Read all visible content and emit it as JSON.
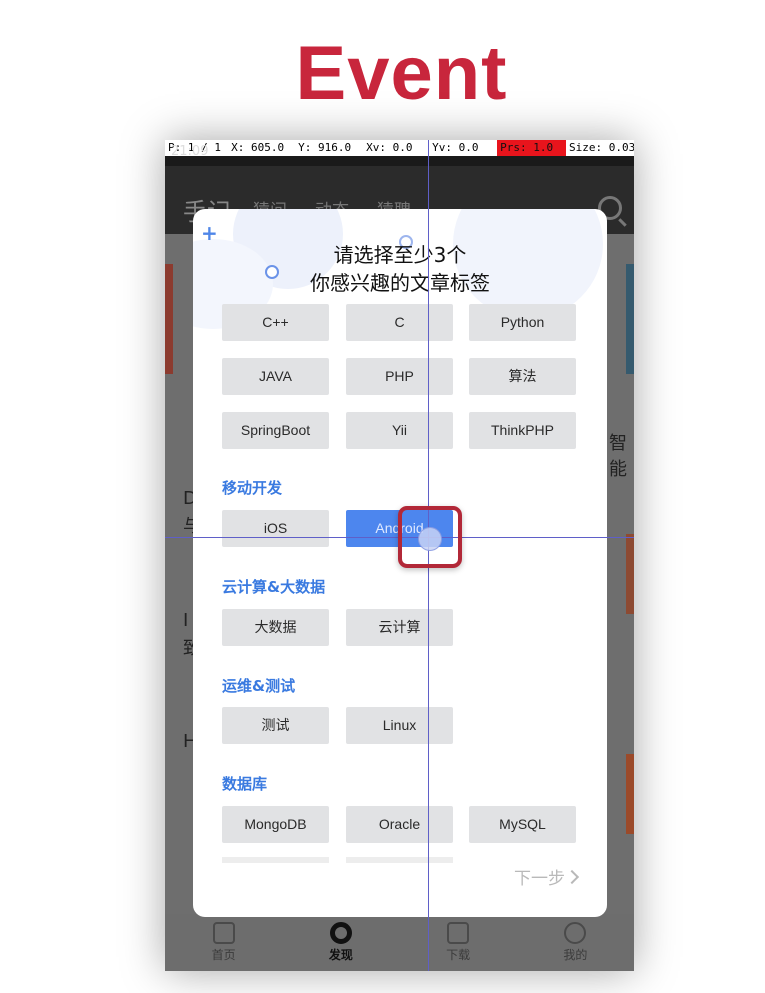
{
  "slide": {
    "title": "Event"
  },
  "debug_bar": {
    "p": "P: 1 / 1",
    "x": "X: 605.0",
    "y": "Y: 916.0",
    "xv": "Xv: 0.0",
    "yv": "Yv: 0.0",
    "prs": "Prs: 1.0",
    "size": "Size: 0.03"
  },
  "status_bar": {
    "time": "21:09"
  },
  "app_bar": {
    "logo": "手记",
    "tabs": [
      "猿问",
      "动态",
      "猿聘"
    ]
  },
  "background": {
    "right_text": "智能",
    "left_letters": [
      "D",
      "与",
      "I",
      "致",
      "H"
    ]
  },
  "dialog": {
    "title_line1": "请选择至少3个",
    "title_line2": "你感兴趣的文章标签",
    "groups": [
      {
        "heading": "",
        "tags": [
          "C++",
          "C",
          "Python",
          "JAVA",
          "PHP",
          "算法",
          "SpringBoot",
          "Yii",
          "ThinkPHP"
        ]
      },
      {
        "heading": "移动开发",
        "tags": [
          "iOS",
          "Android"
        ],
        "selected": "Android"
      },
      {
        "heading": "云计算&大数据",
        "tags": [
          "大数据",
          "云计算"
        ]
      },
      {
        "heading": "运维&测试",
        "tags": [
          "测试",
          "Linux"
        ]
      },
      {
        "heading": "数据库",
        "tags": [
          "MongoDB",
          "Oracle",
          "MySQL"
        ]
      }
    ],
    "next_label": "下一步"
  },
  "bottom_nav": [
    {
      "label": "首页",
      "icon": "home-icon"
    },
    {
      "label": "发现",
      "icon": "discover-icon"
    },
    {
      "label": "下载",
      "icon": "download-icon"
    },
    {
      "label": "我的",
      "icon": "profile-icon"
    }
  ],
  "colors": {
    "title": "#c8263c",
    "accent": "#3a7ae0",
    "selected_tag": "#4d86ee",
    "highlight": "#b22838",
    "crosshair": "#5f5fc8"
  }
}
